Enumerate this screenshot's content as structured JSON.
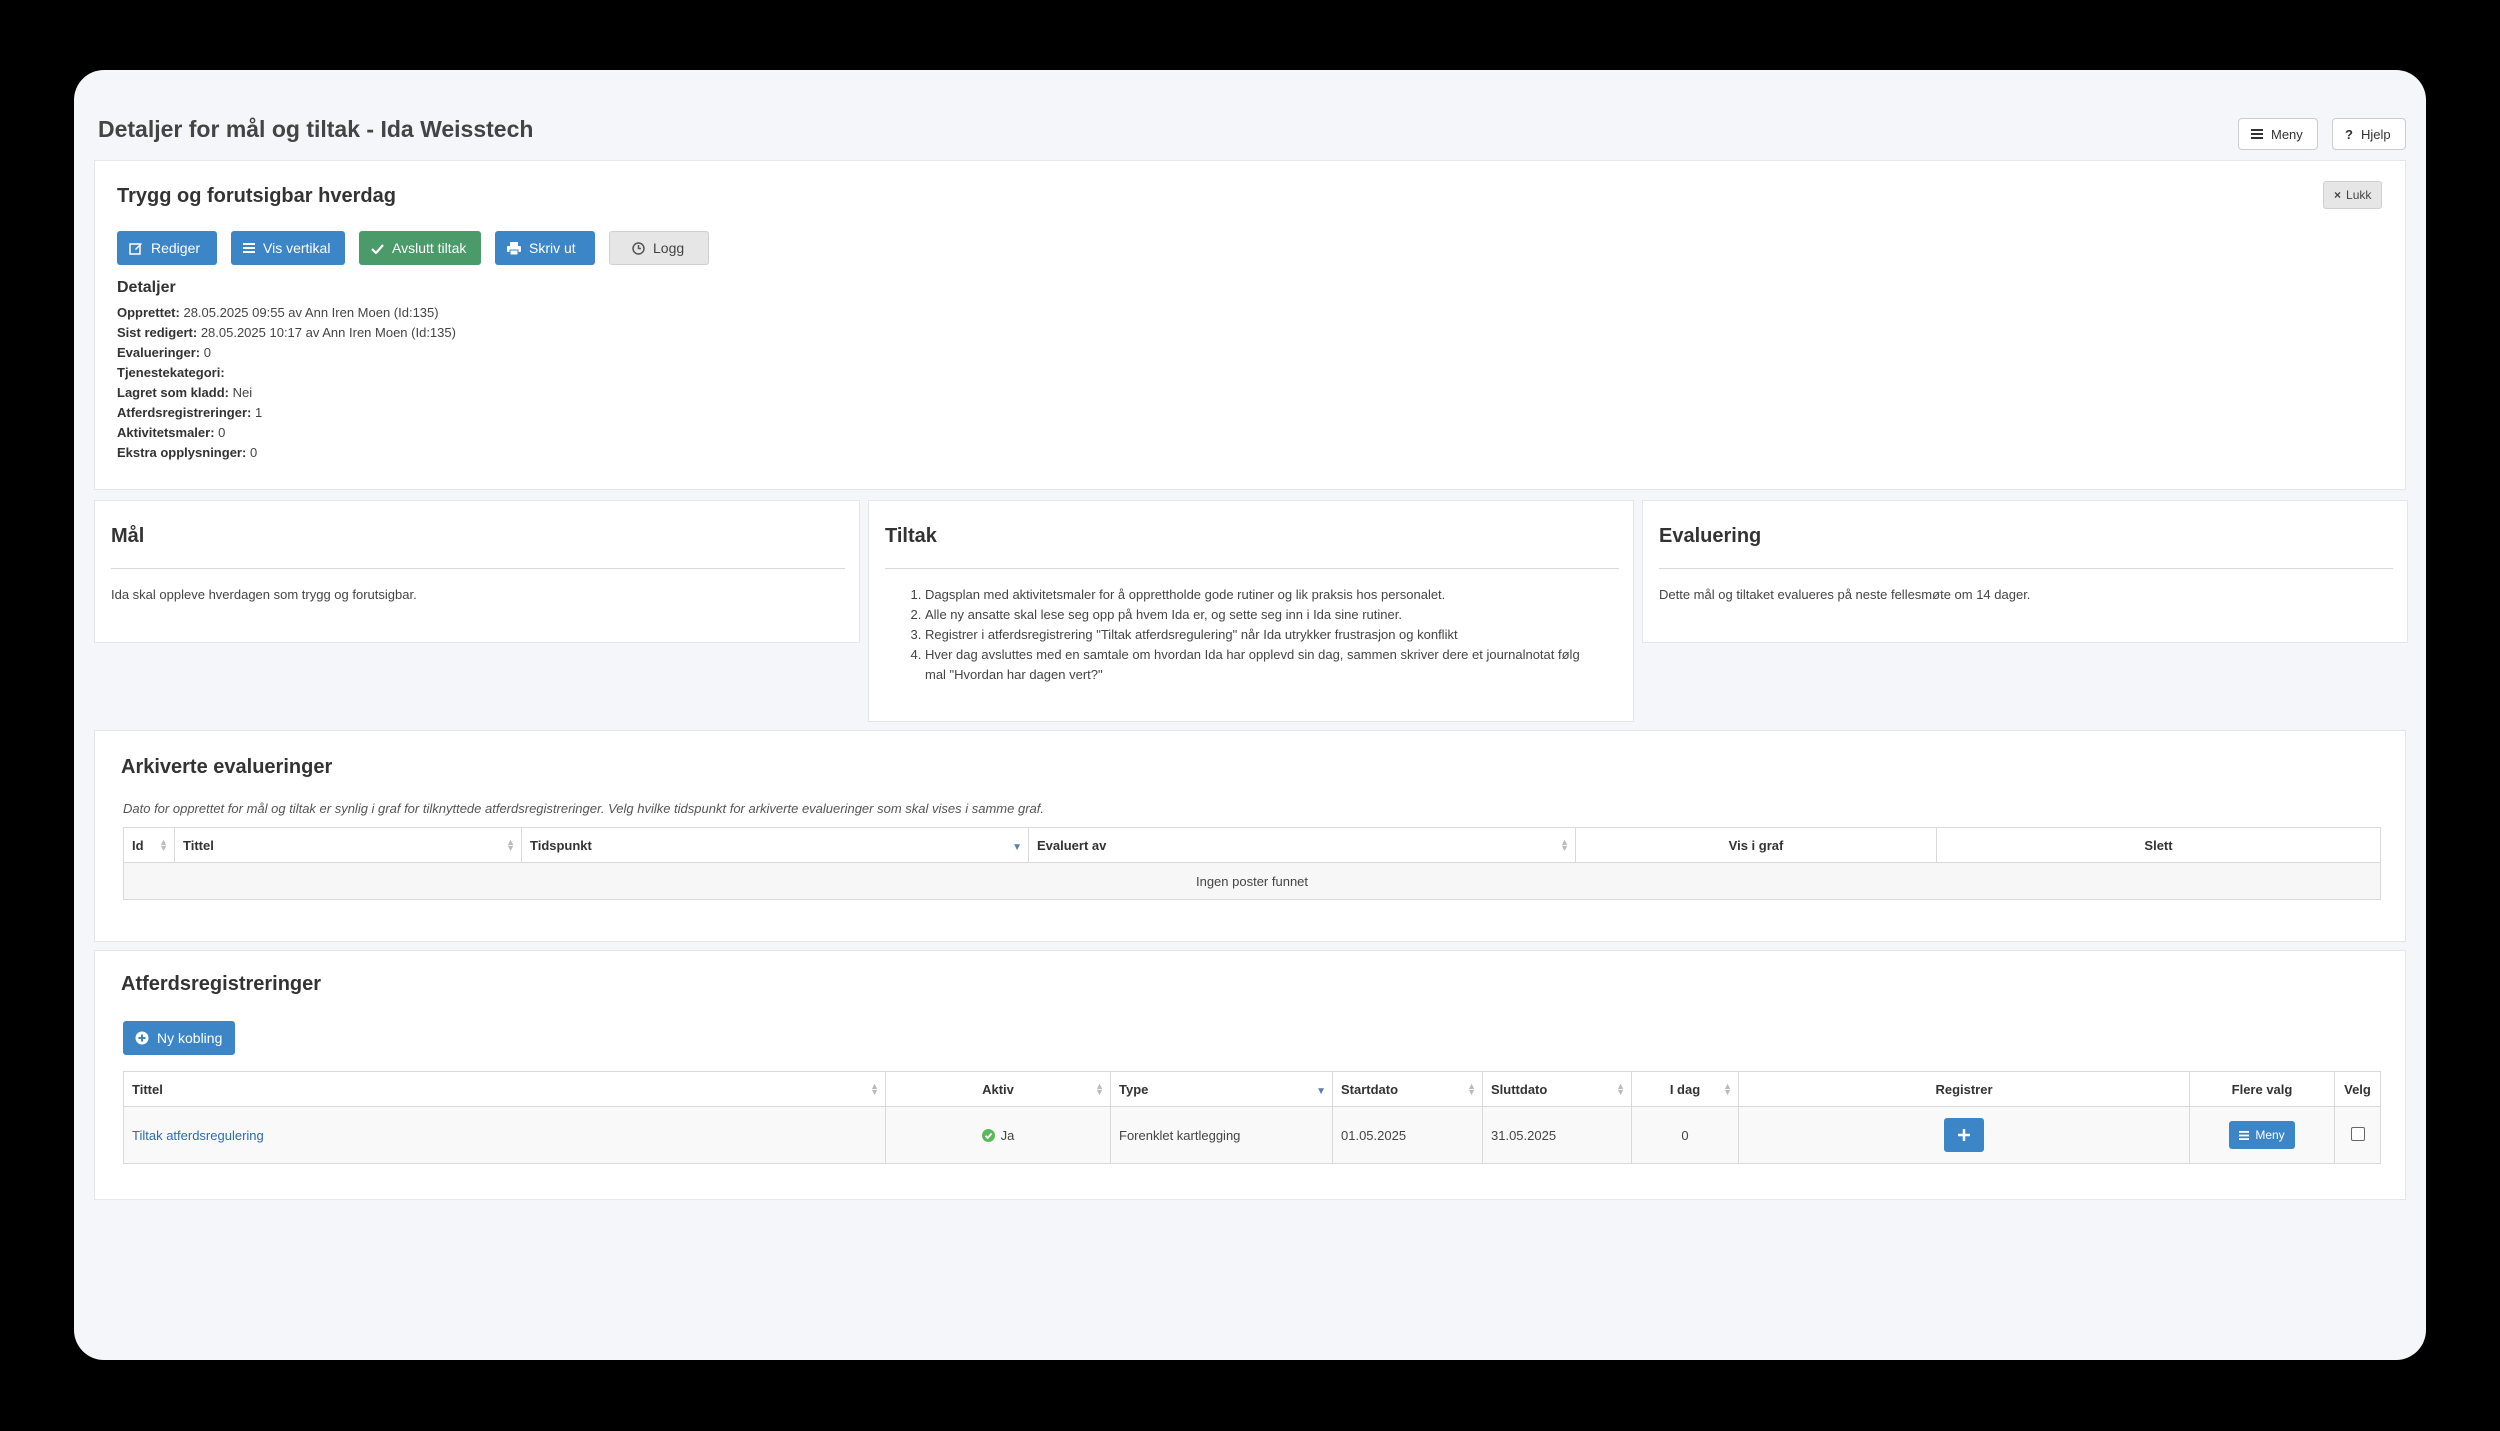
{
  "page": {
    "title": "Detaljer for mål og tiltak - Ida Weisstech",
    "menu_label": "Meny",
    "help_label": "Hjelp"
  },
  "goal": {
    "title": "Trygg og forutsigbar hverdag",
    "close_label": "Lukk",
    "buttons": {
      "edit": "Rediger",
      "vertical": "Vis vertikal",
      "end": "Avslutt tiltak",
      "print": "Skriv ut",
      "log": "Logg"
    },
    "details_heading": "Detaljer",
    "details": [
      {
        "label": "Opprettet:",
        "value": "28.05.2025 09:55 av Ann Iren Moen (Id:135)"
      },
      {
        "label": "Sist redigert:",
        "value": "28.05.2025 10:17 av Ann Iren Moen (Id:135)"
      },
      {
        "label": "Evalueringer:",
        "value": "0"
      },
      {
        "label": "Tjenestekategori:",
        "value": ""
      },
      {
        "label": "Lagret som kladd:",
        "value": "Nei"
      },
      {
        "label": "Atferdsregistreringer:",
        "value": "1"
      },
      {
        "label": "Aktivitetsmaler:",
        "value": "0"
      },
      {
        "label": "Ekstra opplysninger:",
        "value": "0"
      }
    ]
  },
  "maal": {
    "title": "Mål",
    "text": "Ida skal oppleve hverdagen som trygg og forutsigbar."
  },
  "tiltak": {
    "title": "Tiltak",
    "items": [
      "Dagsplan med aktivitetsmaler for å opprettholde gode rutiner og lik praksis hos personalet.",
      "Alle ny ansatte skal lese seg opp på hvem Ida er, og sette seg inn i Ida sine rutiner.",
      "Registrer i atferdsregistrering \"Tiltak atferdsregulering\" når Ida utrykker frustrasjon og konflikt",
      "Hver dag avsluttes med en samtale om hvordan Ida har opplevd sin dag, sammen skriver dere et journalnotat følg mal \"Hvordan har dagen vert?\""
    ]
  },
  "evaluering": {
    "title": "Evaluering",
    "text": "Dette mål og tiltaket evalueres på neste fellesmøte om 14 dager."
  },
  "archived": {
    "title": "Arkiverte evalueringer",
    "note": "Dato for opprettet for mål og tiltak er synlig i graf for tilknyttede atferdsregistreringer. Velg hvilke tidspunkt for arkiverte evalueringer som skal vises i samme graf.",
    "columns": [
      "Id",
      "Tittel",
      "Tidspunkt",
      "Evaluert av",
      "Vis i graf",
      "Slett"
    ],
    "empty": "Ingen poster funnet"
  },
  "registrations": {
    "title": "Atferdsregistreringer",
    "new_link_label": "Ny kobling",
    "columns": [
      "Tittel",
      "Aktiv",
      "Type",
      "Startdato",
      "Sluttdato",
      "I dag",
      "Registrer",
      "Flere valg",
      "Velg"
    ],
    "rows": [
      {
        "title": "Tiltak atferdsregulering",
        "active": "Ja",
        "type": "Forenklet kartlegging",
        "start": "01.05.2025",
        "end": "31.05.2025",
        "today": "0",
        "menu": "Meny"
      }
    ]
  },
  "colors": {
    "primary": "#3c86c8",
    "success": "#4a9a6a",
    "link": "#2d6bb3",
    "background": "#f4f6f9"
  }
}
